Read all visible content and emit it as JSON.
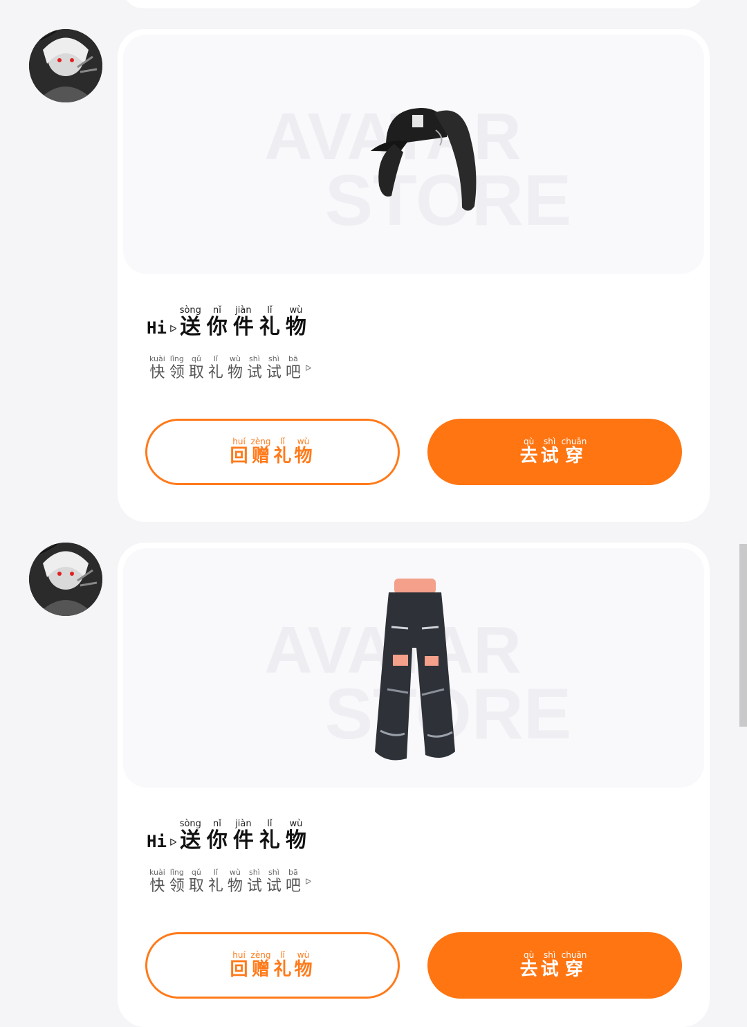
{
  "messages": [
    {
      "item": "hat",
      "watermark": [
        "AVATAR",
        "STORE"
      ],
      "greeting": "Hi",
      "title": [
        {
          "py": "sòng",
          "hz": "送"
        },
        {
          "py": "nǐ",
          "hz": "你"
        },
        {
          "py": "jiàn",
          "hz": "件"
        },
        {
          "py": "lǐ",
          "hz": "礼"
        },
        {
          "py": "wù",
          "hz": "物"
        }
      ],
      "subtitle": [
        {
          "py": "kuài",
          "hz": "快"
        },
        {
          "py": "lǐng",
          "hz": "领"
        },
        {
          "py": "qǔ",
          "hz": "取"
        },
        {
          "py": "lǐ",
          "hz": "礼"
        },
        {
          "py": "wù",
          "hz": "物"
        },
        {
          "py": "shì",
          "hz": "试"
        },
        {
          "py": "shì",
          "hz": "试"
        },
        {
          "py": "bā",
          "hz": "吧"
        }
      ],
      "gift_button": [
        {
          "py": "huí",
          "hz": "回"
        },
        {
          "py": "zèng",
          "hz": "赠"
        },
        {
          "py": "lǐ",
          "hz": "礼"
        },
        {
          "py": "wù",
          "hz": "物"
        }
      ],
      "try_button": [
        {
          "py": "qù",
          "hz": "去"
        },
        {
          "py": "shì",
          "hz": "试"
        },
        {
          "py": "chuān",
          "hz": "穿"
        }
      ]
    },
    {
      "item": "pants",
      "watermark": [
        "AVATAR",
        "STORE"
      ],
      "greeting": "Hi",
      "title": [
        {
          "py": "sòng",
          "hz": "送"
        },
        {
          "py": "nǐ",
          "hz": "你"
        },
        {
          "py": "jiàn",
          "hz": "件"
        },
        {
          "py": "lǐ",
          "hz": "礼"
        },
        {
          "py": "wù",
          "hz": "物"
        }
      ],
      "subtitle": [
        {
          "py": "kuài",
          "hz": "快"
        },
        {
          "py": "lǐng",
          "hz": "领"
        },
        {
          "py": "qǔ",
          "hz": "取"
        },
        {
          "py": "lǐ",
          "hz": "礼"
        },
        {
          "py": "wù",
          "hz": "物"
        },
        {
          "py": "shì",
          "hz": "试"
        },
        {
          "py": "shì",
          "hz": "试"
        },
        {
          "py": "bā",
          "hz": "吧"
        }
      ],
      "gift_button": [
        {
          "py": "huí",
          "hz": "回"
        },
        {
          "py": "zèng",
          "hz": "赠"
        },
        {
          "py": "lǐ",
          "hz": "礼"
        },
        {
          "py": "wù",
          "hz": "物"
        }
      ],
      "try_button": [
        {
          "py": "qù",
          "hz": "去"
        },
        {
          "py": "shì",
          "hz": "试"
        },
        {
          "py": "chuān",
          "hz": "穿"
        }
      ]
    }
  ],
  "colors": {
    "accent": "#ff7512",
    "background": "#f5f5f7",
    "card": "#ffffff"
  }
}
